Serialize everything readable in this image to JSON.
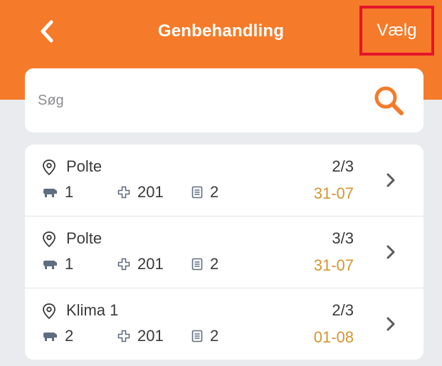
{
  "header": {
    "title": "Genbehandling",
    "select_label": "Vælg",
    "back_icon": "chevron-left-icon"
  },
  "search": {
    "placeholder": "Søg",
    "icon": "search-icon"
  },
  "colors": {
    "header": "#f57b2a",
    "accent": "#f57b2a",
    "date": "#d49530",
    "highlight_border": "#e5142a",
    "background": "#e9ebee"
  },
  "rows": [
    {
      "location": "Polte",
      "animals": "1",
      "treatment": "201",
      "records": "2",
      "progress": "2/3",
      "date": "31-07"
    },
    {
      "location": "Polte",
      "animals": "1",
      "treatment": "201",
      "records": "2",
      "progress": "3/3",
      "date": "31-07"
    },
    {
      "location": "Klima 1",
      "animals": "2",
      "treatment": "201",
      "records": "2",
      "progress": "2/3",
      "date": "01-08"
    }
  ]
}
